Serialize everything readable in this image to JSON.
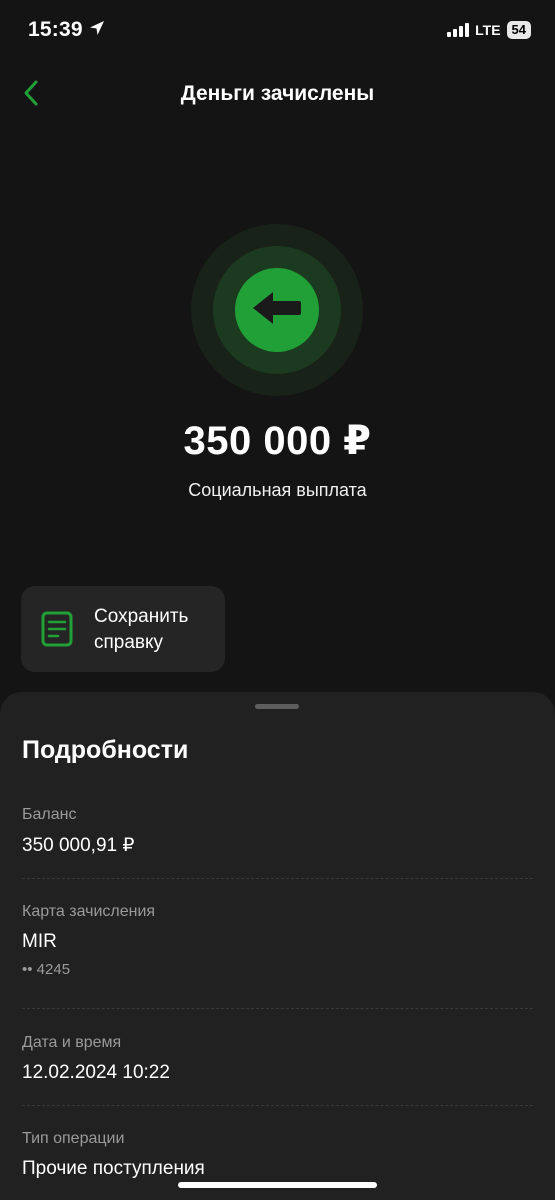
{
  "status_bar": {
    "time": "15:39",
    "network": "LTE",
    "battery": "54"
  },
  "header": {
    "title": "Деньги зачислены"
  },
  "transaction": {
    "amount": "350 000 ₽",
    "description": "Социальная выплата"
  },
  "actions": {
    "save_receipt_label": "Сохранить справку"
  },
  "details": {
    "title": "Подробности",
    "balance_label": "Баланс",
    "balance_value": "350 000,91 ₽",
    "card_label": "Карта зачисления",
    "card_value": "MIR",
    "card_number": "•• 4245",
    "datetime_label": "Дата и время",
    "datetime_value": "12.02.2024 10:22",
    "type_label": "Тип операции",
    "type_value": "Прочие поступления"
  },
  "icons": {
    "back": "chevron-left-icon",
    "hero": "arrow-left-icon",
    "document": "document-icon",
    "location": "location-arrow-icon"
  },
  "colors": {
    "accent_green": "#21a038",
    "background": "#141414",
    "sheet": "#212121",
    "card": "#252525"
  }
}
